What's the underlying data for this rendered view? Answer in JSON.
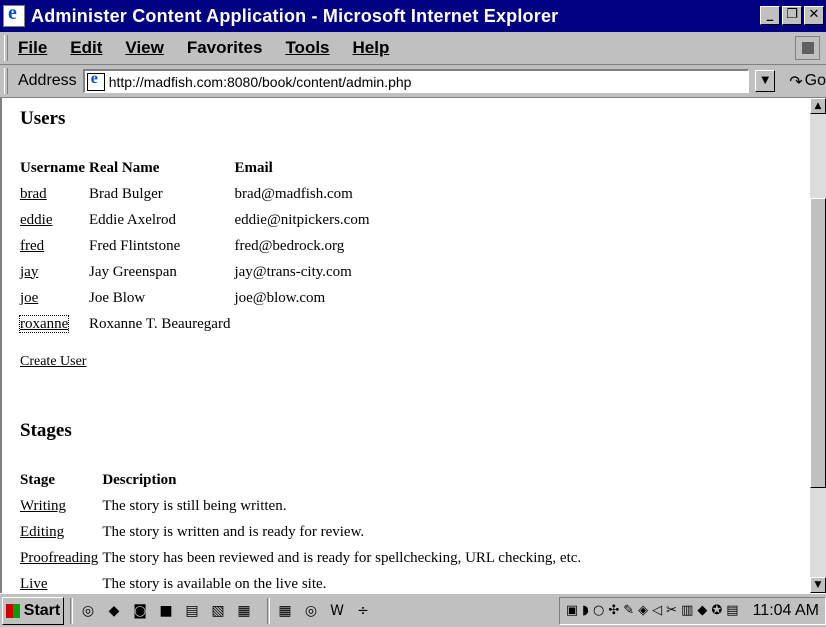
{
  "window": {
    "title": "Administer Content Application - Microsoft Internet Explorer",
    "buttons": [
      "_",
      "❐",
      "✕"
    ]
  },
  "menu": {
    "items": [
      {
        "label": "File",
        "accel": "F"
      },
      {
        "label": "Edit",
        "accel": "E"
      },
      {
        "label": "View",
        "accel": "V"
      },
      {
        "label": "Favorites",
        "accel": "a"
      },
      {
        "label": "Tools",
        "accel": "T"
      },
      {
        "label": "Help",
        "accel": "H"
      }
    ]
  },
  "address": {
    "label": "Address",
    "url": "http://madfish.com:8080/book/content/admin.php",
    "go_label": "Go"
  },
  "users": {
    "heading": "Users",
    "columns": [
      "Username",
      "Real Name",
      "Email"
    ],
    "rows": [
      {
        "username": "brad",
        "real_name": "Brad Bulger",
        "email": "brad@madfish.com"
      },
      {
        "username": "eddie",
        "real_name": "Eddie Axelrod",
        "email": "eddie@nitpickers.com"
      },
      {
        "username": "fred",
        "real_name": "Fred Flintstone",
        "email": "fred@bedrock.org"
      },
      {
        "username": "jay",
        "real_name": "Jay Greenspan",
        "email": "jay@trans-city.com"
      },
      {
        "username": "joe",
        "real_name": "Joe Blow",
        "email": "joe@blow.com"
      },
      {
        "username": "roxanne",
        "real_name": "Roxanne T. Beauregard",
        "email": ""
      }
    ],
    "create_link": "Create User"
  },
  "stages": {
    "heading": "Stages",
    "columns": [
      "Stage",
      "Description"
    ],
    "rows": [
      {
        "stage": "Writing",
        "description": "The story is still being written."
      },
      {
        "stage": "Editing",
        "description": "The story is written and is ready for review."
      },
      {
        "stage": "Proofreading",
        "description": "The story has been reviewed and is ready for spellchecking, URL checking, etc."
      },
      {
        "stage": "Live",
        "description": "The story is available on the live site."
      }
    ]
  },
  "taskbar": {
    "start_label": "Start",
    "clock": "11:04 AM",
    "quick_icons": [
      "ie-icon",
      "outlook-icon",
      "desktop-icon",
      "channels-icon",
      "explorer-icon",
      "notepad-icon",
      "app-icon"
    ],
    "task_icons": [
      "task-app-icon",
      "task-ie-icon",
      "task-word-icon",
      "task-split-icon"
    ],
    "tray_icons": [
      "tray-icon-1",
      "tray-icon-2",
      "tray-icon-3",
      "tray-icon-4",
      "tray-icon-5",
      "tray-icon-6",
      "tray-icon-7",
      "tray-icon-8",
      "tray-icon-9",
      "tray-icon-10",
      "tray-icon-11",
      "tray-icon-12"
    ]
  }
}
